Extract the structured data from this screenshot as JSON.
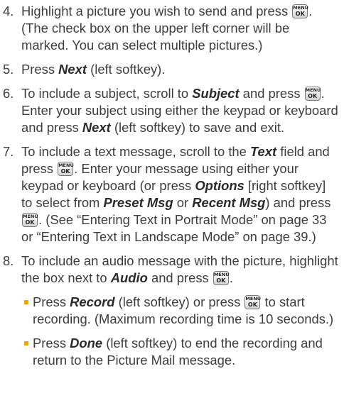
{
  "key_icon": {
    "line1": "MENU",
    "line2": "OK"
  },
  "steps": [
    {
      "num": "4.",
      "t1": "Highlight a picture you wish to send and press ",
      "t2": ". (The check box on the upper left corner will be marked. You can select multiple pictures.)"
    },
    {
      "num": "5.",
      "t1": "Press ",
      "e1": "Next",
      "t2": " (left softkey)."
    },
    {
      "num": "6.",
      "t1": "To include a subject, scroll to ",
      "e1": "Subject",
      "t2": " and press ",
      "t3": ". Enter your subject using either the keypad or keyboard and press ",
      "e2": "Next",
      "t4": " (left softkey) to save and exit."
    },
    {
      "num": "7.",
      "t1": "To include a text message, scroll to the ",
      "e1": "Text",
      "t2": " field and press ",
      "t3": ". Enter your message using either your keypad or keyboard (or press ",
      "e2": "Options",
      "t4": " [right softkey] to select from ",
      "e3": "Preset Msg",
      "t5": " or ",
      "e4": "Recent Msg",
      "t6": ") and press ",
      "t7": ". (See “Entering Text in Portrait Mode” on page 33 or “Entering Text in Landscape Mode” on page 39.)"
    },
    {
      "num": "8.",
      "t1": "To include an audio message with the picture, highlight the box next to ",
      "e1": "Audio",
      "t2": " and press ",
      "t3": "."
    }
  ],
  "bullets": [
    {
      "t1": "Press ",
      "e1": "Record",
      "t2": " (left softkey) or press ",
      "t3": " to start recording. (Maximum recording time is 10 seconds.)"
    },
    {
      "t1": "Press ",
      "e1": "Done",
      "t2": " (left softkey) to end the recording and return to the Picture Mail message."
    }
  ]
}
